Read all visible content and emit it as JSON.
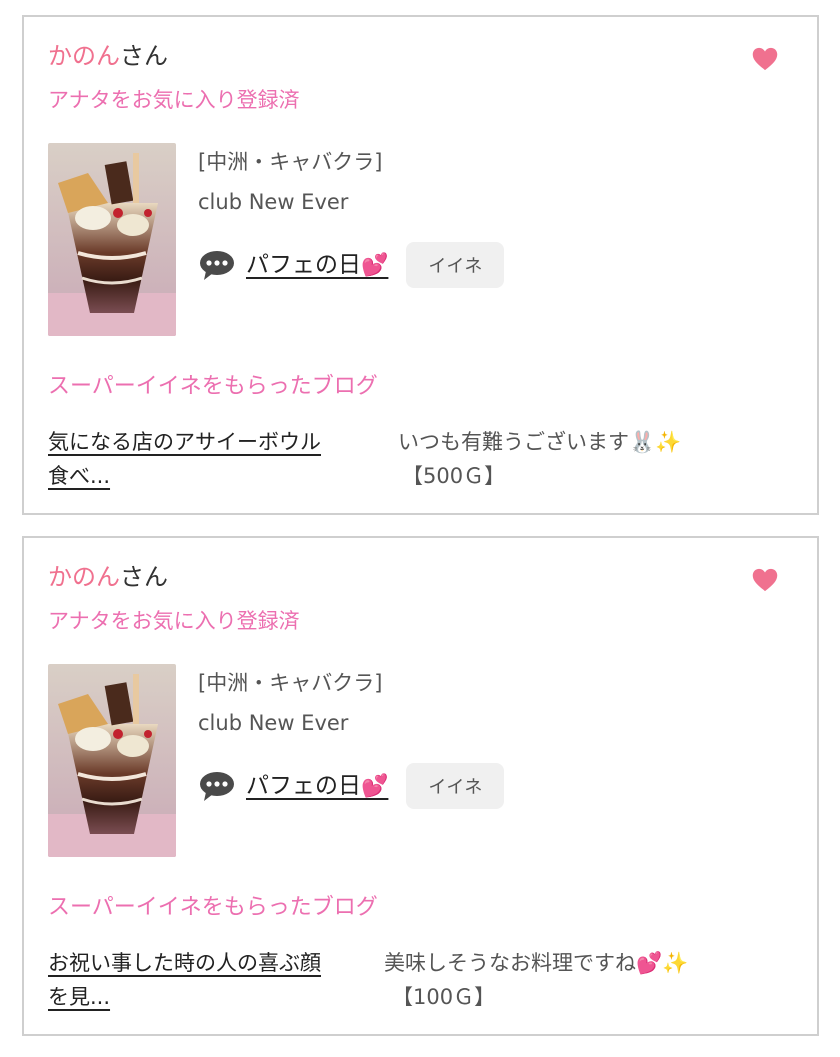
{
  "notifications": [
    {
      "user_name": "かのん",
      "honorific": "さん",
      "favorite_status": "アナタをお気に入り登録済",
      "shop_category": "[中洲・キャバクラ]",
      "shop_name": "club New Ever",
      "blog_title": "パフェの日",
      "blog_title_emoji": "💕",
      "like_label": "イイネ",
      "super_like_heading": "スーパーイイネをもらったブログ",
      "super_like_blog_line1": "気になる店のアサイーボウル",
      "super_like_blog_line2": "食べ...",
      "super_like_comment": "いつも有難うございます🐰✨",
      "super_like_points": "【500Ｇ】"
    },
    {
      "user_name": "かのん",
      "honorific": "さん",
      "favorite_status": "アナタをお気に入り登録済",
      "shop_category": "[中洲・キャバクラ]",
      "shop_name": "club New Ever",
      "blog_title": "パフェの日",
      "blog_title_emoji": "💕",
      "like_label": "イイネ",
      "super_like_heading": "スーパーイイネをもらったブログ",
      "super_like_blog_line1": "お祝い事した時の人の喜ぶ顔",
      "super_like_blog_line2": "を見...",
      "super_like_comment": "美味しそうなお料理ですね💕✨",
      "super_like_points": "【100Ｇ】"
    }
  ],
  "colors": {
    "name_pink": "#f0718f",
    "accent_pink": "#ec6fb0",
    "heart": "#f0718f",
    "border": "#cfcfcf",
    "button_bg": "#f0f0f0"
  },
  "icons": {
    "heart": "heart-icon",
    "comment": "comment-bubble-icon"
  }
}
